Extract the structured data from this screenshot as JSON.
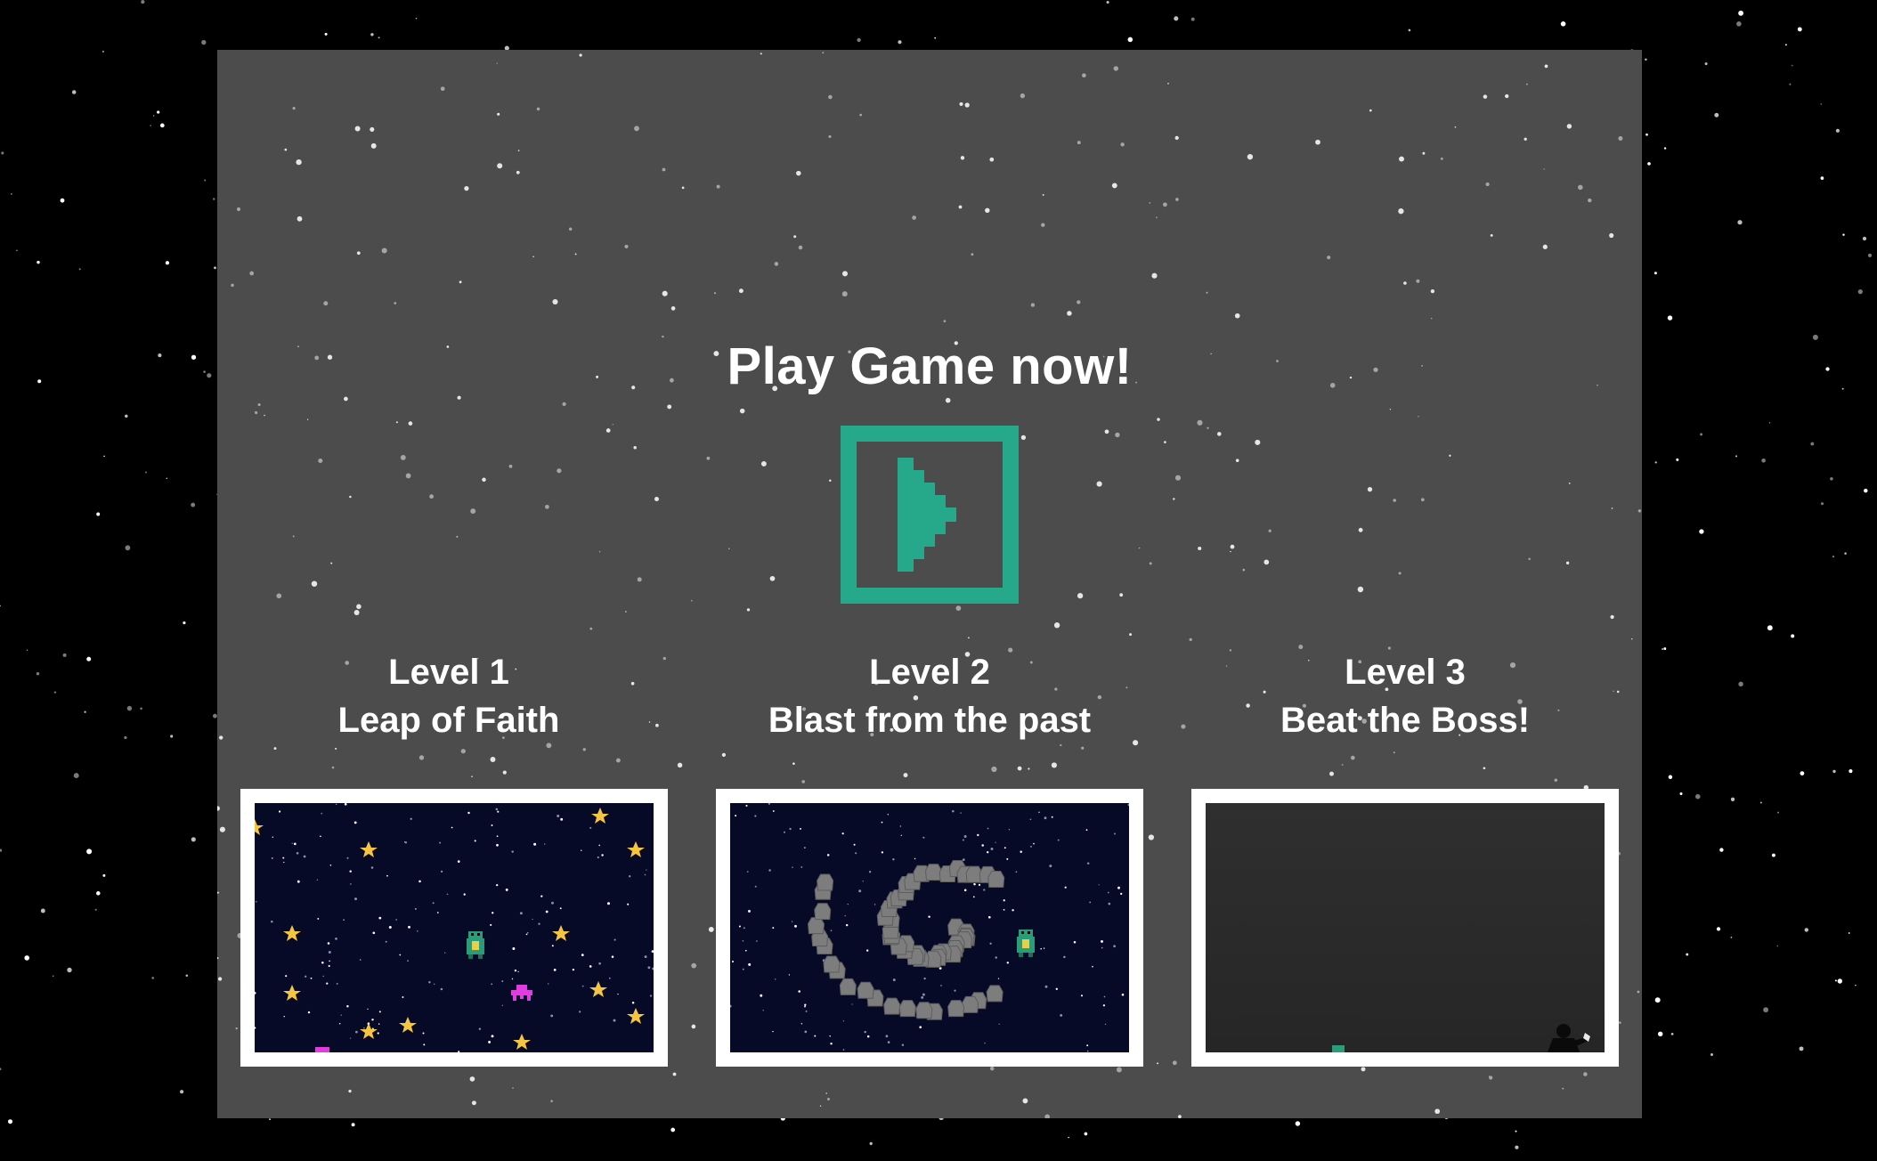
{
  "title": "Play Game now!",
  "play_button": {
    "icon": "play-icon",
    "color": "#25a98a"
  },
  "levels": [
    {
      "number": "Level 1",
      "name": "Leap of Faith"
    },
    {
      "number": "Level 2",
      "name": "Blast from the past"
    },
    {
      "number": "Level 3",
      "name": "Beat the Boss!"
    }
  ],
  "colors": {
    "page_background": "#000000",
    "panel_background": "#4c4c4c",
    "accent": "#25a98a",
    "thumb_border": "#ffffff",
    "space_background": "#060a26",
    "star": "#f5c542",
    "alien": "#e03ce0"
  }
}
